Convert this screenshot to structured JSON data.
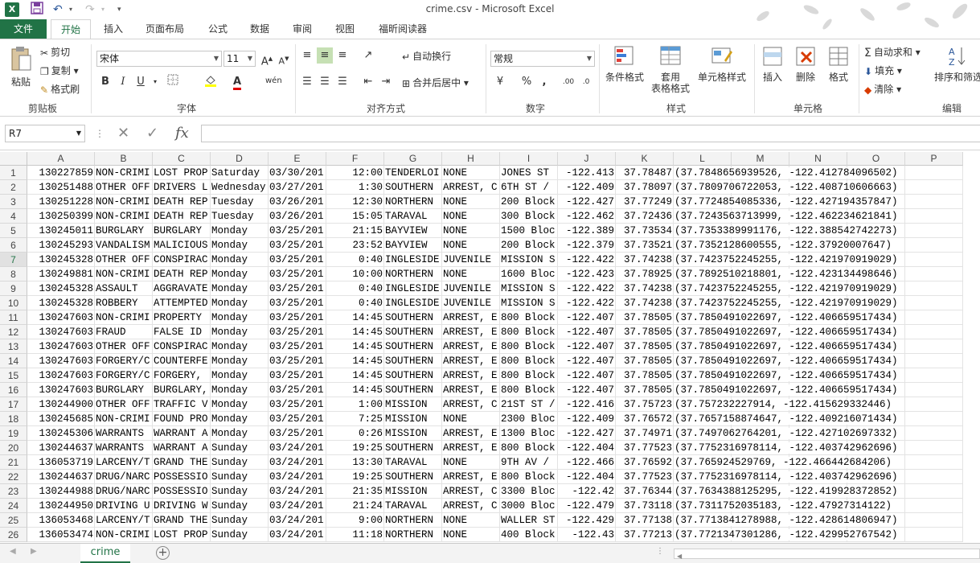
{
  "window": {
    "title": "crime.csv - Microsoft Excel"
  },
  "ribbon_tabs": [
    "文件",
    "开始",
    "插入",
    "页面布局",
    "公式",
    "数据",
    "审阅",
    "视图",
    "福昕阅读器"
  ],
  "ribbon": {
    "clipboard": {
      "paste": "粘贴",
      "cut": "剪切",
      "copy": "复制",
      "format_painter": "格式刷",
      "label": "剪贴板"
    },
    "font": {
      "name": "宋体",
      "size": "11",
      "label": "字体"
    },
    "alignment": {
      "wrap_text": "自动换行",
      "merge_center": "合并后居中",
      "label": "对齐方式"
    },
    "number": {
      "format": "常规",
      "label": "数字"
    },
    "styles": {
      "conditional": "条件格式",
      "table_line1": "套用",
      "table_line2": "表格格式",
      "cell_styles": "单元格样式",
      "label": "样式"
    },
    "cells": {
      "insert": "插入",
      "delete": "删除",
      "format": "格式",
      "label": "单元格"
    },
    "editing": {
      "autosum": "自动求和",
      "fill": "填充",
      "clear": "清除",
      "sort_filter": "排序和筛选",
      "label": "编辑"
    }
  },
  "formula_bar": {
    "name_box": "R7",
    "fx": "fx",
    "value": ""
  },
  "columns": [
    "A",
    "B",
    "C",
    "D",
    "E",
    "F",
    "G",
    "H",
    "I",
    "J",
    "K",
    "L",
    "M",
    "N",
    "O",
    "P"
  ],
  "rows": [
    {
      "n": "1",
      "a": "130227859",
      "b": "NON-CRIMI",
      "c": "LOST PROP",
      "d": "Saturday",
      "e": "03/30/201",
      "f": "12:00",
      "g": "TENDERLOI",
      "h": "NONE",
      "i": "JONES ST",
      "j": "-122.413",
      "k": "37.78487",
      "l": "(37.7848656939526, -122.412784096502)"
    },
    {
      "n": "2",
      "a": "130251488",
      "b": "OTHER OFF",
      "c": "DRIVERS L",
      "d": "Wednesday",
      "e": "03/27/201",
      "f": "1:30",
      "g": "SOUTHERN",
      "h": "ARREST, C",
      "i": "6TH ST /",
      "j": "-122.409",
      "k": "37.78097",
      "l": "(37.7809706722053, -122.408710606663)"
    },
    {
      "n": "3",
      "a": "130251228",
      "b": "NON-CRIMI",
      "c": "DEATH REP",
      "d": "Tuesday",
      "e": "03/26/201",
      "f": "12:30",
      "g": "NORTHERN",
      "h": "NONE",
      "i": "200 Block",
      "j": "-122.427",
      "k": "37.77249",
      "l": "(37.7724854085336, -122.427194357847)"
    },
    {
      "n": "4",
      "a": "130250399",
      "b": "NON-CRIMI",
      "c": "DEATH REP",
      "d": "Tuesday",
      "e": "03/26/201",
      "f": "15:05",
      "g": "TARAVAL",
      "h": "NONE",
      "i": "300 Block",
      "j": "-122.462",
      "k": "37.72436",
      "l": "(37.7243563713999, -122.462234621841)"
    },
    {
      "n": "5",
      "a": "130245011",
      "b": "BURGLARY",
      "c": "BURGLARY",
      "d": "Monday",
      "e": "03/25/201",
      "f": "21:15",
      "g": "BAYVIEW",
      "h": "NONE",
      "i": "1500 Bloc",
      "j": "-122.389",
      "k": "37.73534",
      "l": "(37.7353389991176, -122.388542742273)"
    },
    {
      "n": "6",
      "a": "130245293",
      "b": "VANDALISM",
      "c": "MALICIOUS",
      "d": "Monday",
      "e": "03/25/201",
      "f": "23:52",
      "g": "BAYVIEW",
      "h": "NONE",
      "i": "200 Block",
      "j": "-122.379",
      "k": "37.73521",
      "l": "(37.7352128600555, -122.37920007647)"
    },
    {
      "n": "7",
      "a": "130245328",
      "b": "OTHER OFF",
      "c": "CONSPIRAC",
      "d": "Monday",
      "e": "03/25/201",
      "f": "0:40",
      "g": "INGLESIDE",
      "h": "JUVENILE",
      "i": "MISSION S",
      "j": "-122.422",
      "k": "37.74238",
      "l": "(37.7423752245255, -122.421970919029)"
    },
    {
      "n": "8",
      "a": "130249881",
      "b": "NON-CRIMI",
      "c": "DEATH REP",
      "d": "Monday",
      "e": "03/25/201",
      "f": "10:00",
      "g": "NORTHERN",
      "h": "NONE",
      "i": "1600 Bloc",
      "j": "-122.423",
      "k": "37.78925",
      "l": "(37.7892510218801, -122.423134498646)"
    },
    {
      "n": "9",
      "a": "130245328",
      "b": "ASSAULT",
      "c": "AGGRAVATE",
      "d": "Monday",
      "e": "03/25/201",
      "f": "0:40",
      "g": "INGLESIDE",
      "h": "JUVENILE",
      "i": "MISSION S",
      "j": "-122.422",
      "k": "37.74238",
      "l": "(37.7423752245255, -122.421970919029)"
    },
    {
      "n": "10",
      "a": "130245328",
      "b": "ROBBERY",
      "c": "ATTEMPTED",
      "d": "Monday",
      "e": "03/25/201",
      "f": "0:40",
      "g": "INGLESIDE",
      "h": "JUVENILE",
      "i": "MISSION S",
      "j": "-122.422",
      "k": "37.74238",
      "l": "(37.7423752245255, -122.421970919029)"
    },
    {
      "n": "11",
      "a": "130247603",
      "b": "NON-CRIMI",
      "c": "PROPERTY",
      "d": "Monday",
      "e": "03/25/201",
      "f": "14:45",
      "g": "SOUTHERN",
      "h": "ARREST, E",
      "i": "800 Block",
      "j": "-122.407",
      "k": "37.78505",
      "l": "(37.7850491022697, -122.406659517434)"
    },
    {
      "n": "12",
      "a": "130247603",
      "b": "FRAUD",
      "c": "FALSE ID",
      "d": "Monday",
      "e": "03/25/201",
      "f": "14:45",
      "g": "SOUTHERN",
      "h": "ARREST, E",
      "i": "800 Block",
      "j": "-122.407",
      "k": "37.78505",
      "l": "(37.7850491022697, -122.406659517434)"
    },
    {
      "n": "13",
      "a": "130247603",
      "b": "OTHER OFF",
      "c": "CONSPIRAC",
      "d": "Monday",
      "e": "03/25/201",
      "f": "14:45",
      "g": "SOUTHERN",
      "h": "ARREST, E",
      "i": "800 Block",
      "j": "-122.407",
      "k": "37.78505",
      "l": "(37.7850491022697, -122.406659517434)"
    },
    {
      "n": "14",
      "a": "130247603",
      "b": "FORGERY/C",
      "c": "COUNTERFE",
      "d": "Monday",
      "e": "03/25/201",
      "f": "14:45",
      "g": "SOUTHERN",
      "h": "ARREST, E",
      "i": "800 Block",
      "j": "-122.407",
      "k": "37.78505",
      "l": "(37.7850491022697, -122.406659517434)"
    },
    {
      "n": "15",
      "a": "130247603",
      "b": "FORGERY/C",
      "c": "FORGERY,",
      "d": "Monday",
      "e": "03/25/201",
      "f": "14:45",
      "g": "SOUTHERN",
      "h": "ARREST, E",
      "i": "800 Block",
      "j": "-122.407",
      "k": "37.78505",
      "l": "(37.7850491022697, -122.406659517434)"
    },
    {
      "n": "16",
      "a": "130247603",
      "b": "BURGLARY",
      "c": "BURGLARY,",
      "d": "Monday",
      "e": "03/25/201",
      "f": "14:45",
      "g": "SOUTHERN",
      "h": "ARREST, E",
      "i": "800 Block",
      "j": "-122.407",
      "k": "37.78505",
      "l": "(37.7850491022697, -122.406659517434)"
    },
    {
      "n": "17",
      "a": "130244900",
      "b": "OTHER OFF",
      "c": "TRAFFIC V",
      "d": "Monday",
      "e": "03/25/201",
      "f": "1:00",
      "g": "MISSION",
      "h": "ARREST, C",
      "i": "21ST ST /",
      "j": "-122.416",
      "k": "37.75723",
      "l": "(37.757232227914, -122.415629332446)"
    },
    {
      "n": "18",
      "a": "130245685",
      "b": "NON-CRIMI",
      "c": "FOUND PRO",
      "d": "Monday",
      "e": "03/25/201",
      "f": "7:25",
      "g": "MISSION",
      "h": "NONE",
      "i": "2300 Bloc",
      "j": "-122.409",
      "k": "37.76572",
      "l": "(37.7657158874647, -122.409216071434)"
    },
    {
      "n": "19",
      "a": "130245306",
      "b": "WARRANTS",
      "c": "WARRANT A",
      "d": "Monday",
      "e": "03/25/201",
      "f": "0:26",
      "g": "MISSION",
      "h": "ARREST, E",
      "i": "1300 Bloc",
      "j": "-122.427",
      "k": "37.74971",
      "l": "(37.7497062764201, -122.427102697332)"
    },
    {
      "n": "20",
      "a": "130244637",
      "b": "WARRANTS",
      "c": "WARRANT A",
      "d": "Sunday",
      "e": "03/24/201",
      "f": "19:25",
      "g": "SOUTHERN",
      "h": "ARREST, E",
      "i": "800 Block",
      "j": "-122.404",
      "k": "37.77523",
      "l": "(37.7752316978114, -122.403742962696)"
    },
    {
      "n": "21",
      "a": "136053719",
      "b": "LARCENY/T",
      "c": "GRAND THE",
      "d": "Sunday",
      "e": "03/24/201",
      "f": "13:30",
      "g": "TARAVAL",
      "h": "NONE",
      "i": "9TH AV /",
      "j": "-122.466",
      "k": "37.76592",
      "l": "(37.765924529769, -122.466442684206)"
    },
    {
      "n": "22",
      "a": "130244637",
      "b": "DRUG/NARC",
      "c": "POSSESSIO",
      "d": "Sunday",
      "e": "03/24/201",
      "f": "19:25",
      "g": "SOUTHERN",
      "h": "ARREST, E",
      "i": "800 Block",
      "j": "-122.404",
      "k": "37.77523",
      "l": "(37.7752316978114, -122.403742962696)"
    },
    {
      "n": "23",
      "a": "130244988",
      "b": "DRUG/NARC",
      "c": "POSSESSIO",
      "d": "Sunday",
      "e": "03/24/201",
      "f": "21:35",
      "g": "MISSION",
      "h": "ARREST, C",
      "i": "3300 Bloc",
      "j": "-122.42",
      "k": "37.76344",
      "l": "(37.7634388125295, -122.419928372852)"
    },
    {
      "n": "24",
      "a": "130244950",
      "b": "DRIVING U",
      "c": "DRIVING W",
      "d": "Sunday",
      "e": "03/24/201",
      "f": "21:24",
      "g": "TARAVAL",
      "h": "ARREST, C",
      "i": "3000 Bloc",
      "j": "-122.479",
      "k": "37.73118",
      "l": "(37.7311752035183, -122.47927314122)"
    },
    {
      "n": "25",
      "a": "136053468",
      "b": "LARCENY/T",
      "c": "GRAND THE",
      "d": "Sunday",
      "e": "03/24/201",
      "f": "9:00",
      "g": "NORTHERN",
      "h": "NONE",
      "i": "WALLER ST",
      "j": "-122.429",
      "k": "37.77138",
      "l": "(37.7713841278988, -122.428614806947)"
    },
    {
      "n": "26",
      "a": "136053474",
      "b": "NON-CRIMI",
      "c": "LOST PROP",
      "d": "Sunday",
      "e": "03/24/201",
      "f": "11:18",
      "g": "NORTHERN",
      "h": "NONE",
      "i": "400 Block",
      "j": "-122.43",
      "k": "37.77213",
      "l": "(37.7721347301286, -122.429952767542)"
    }
  ],
  "sheet_tabs": [
    "crime"
  ],
  "colors": {
    "excel_green": "#217346"
  }
}
